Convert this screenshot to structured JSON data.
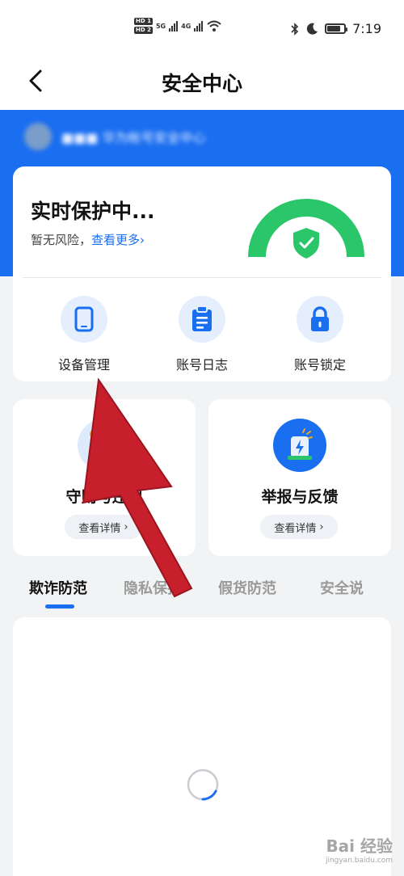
{
  "status_bar": {
    "hd1": "HD 1",
    "hd2": "HD 2",
    "net1": "5G",
    "net2": "4G",
    "time": "7:19",
    "icons": [
      "bluetooth-icon",
      "moon-icon",
      "battery-icon",
      "wifi-icon",
      "signal-icon"
    ]
  },
  "header": {
    "title": "安全中心",
    "back_icon": "chevron-left-icon"
  },
  "user": {
    "blurred_text": "■■■ 华为帐号安全中心"
  },
  "protection": {
    "title": "实时保护中...",
    "subtitle": "暂无风险，",
    "link": "查看更多",
    "link_suffix": "›",
    "gauge_color": "#2bc66a"
  },
  "quick_actions": [
    {
      "label": "设备管理",
      "icon": "phone-icon"
    },
    {
      "label": "账号日志",
      "icon": "clipboard-icon"
    },
    {
      "label": "账号锁定",
      "icon": "lock-icon"
    }
  ],
  "features": [
    {
      "title": "守则与违规",
      "button": "查看详情",
      "chevron": "›",
      "icon": "rules-document-icon"
    },
    {
      "title": "举报与反馈",
      "button": "查看详情",
      "chevron": "›",
      "icon": "report-feedback-icon"
    }
  ],
  "tabs": [
    {
      "label": "欺诈防范",
      "active": true
    },
    {
      "label": "隐私保护",
      "active": false
    },
    {
      "label": "假货防范",
      "active": false
    },
    {
      "label": "安全说",
      "active": false
    }
  ],
  "watermark": {
    "main": "Bai 经验",
    "sub": "jingyan.baidu.com"
  },
  "colors": {
    "brand": "#1a6ef0",
    "safe_green": "#2bc66a",
    "annotation_arrow": "#c7202c"
  }
}
